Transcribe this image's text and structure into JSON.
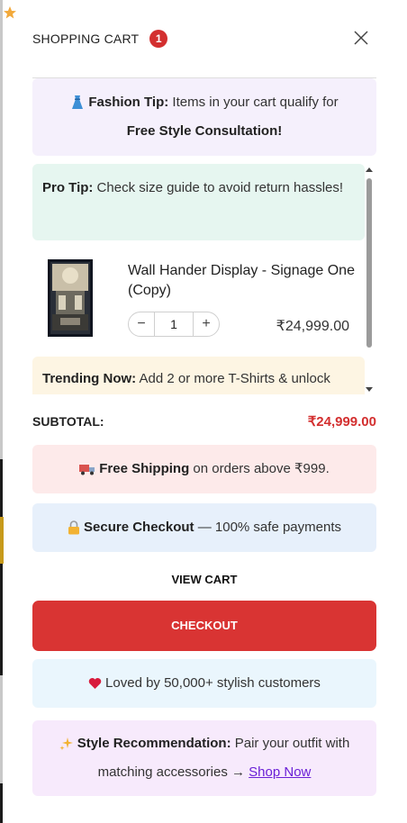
{
  "header": {
    "title": "SHOPPING CART",
    "badge_count": "1"
  },
  "fashion_tip": {
    "label": "Fashion Tip:",
    "text": " Items in your cart qualify for",
    "highlight": "Free Style Consultation!"
  },
  "pro_tip": {
    "label": "Pro Tip:",
    "text": " Check size guide to avoid return hassles!"
  },
  "item": {
    "name": "Wall Hander Display - Signage One (Copy)",
    "qty": "1",
    "minus": "−",
    "plus": "+",
    "price": "₹24,999.00"
  },
  "trending": {
    "label": "Trending Now:",
    "text": " Add 2 or more T-Shirts & unlock"
  },
  "subtotal": {
    "label": "SUBTOTAL:",
    "value": "₹24,999.00"
  },
  "shipping": {
    "label": "Free Shipping",
    "text": " on orders above ₹999."
  },
  "secure": {
    "label": "Secure Checkout",
    "text": " — 100% safe payments"
  },
  "buttons": {
    "view_cart": "VIEW CART",
    "checkout": "CHECKOUT"
  },
  "loved": {
    "text": "Loved by 50,000+ stylish customers"
  },
  "style_rec": {
    "label": "Style Recommendation:",
    "text": " Pair your outfit with matching accessories → ",
    "link": "Shop Now"
  },
  "colors": {
    "accent_red": "#d93433",
    "badge_red": "#d32f2f",
    "link_purple": "#6a1fd6"
  },
  "icons": {
    "star": "star-icon",
    "close": "close-icon",
    "dress": "dress-icon",
    "truck": "truck-icon",
    "lock": "lock-icon",
    "heart": "heart-icon",
    "sparkles": "sparkles-icon"
  }
}
